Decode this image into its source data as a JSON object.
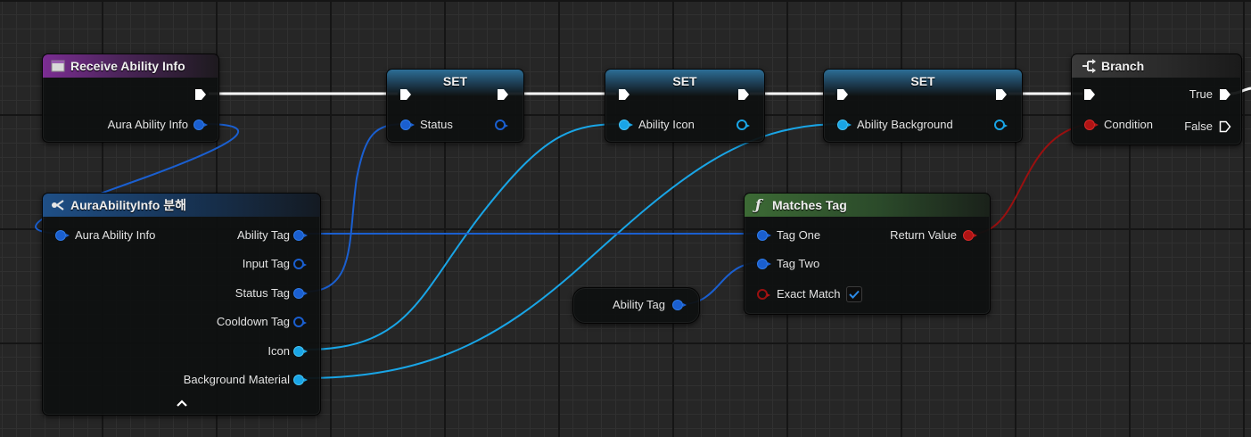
{
  "colors": {
    "grid_background": "#262626",
    "exec_wire": "#ffffff",
    "struct_wire": "#1a5fd0",
    "object_wire": "#19a5e6",
    "bool_wire": "#9a1010"
  },
  "nodes": {
    "receive": {
      "title": "Receive Ability Info",
      "icon": "event-icon",
      "output_pin": "Aura Ability Info"
    },
    "break": {
      "title": "AuraAbilityInfo 분해",
      "icon": "break-struct-icon",
      "input_pin": "Aura Ability Info",
      "outputs": [
        "Ability Tag",
        "Input Tag",
        "Status Tag",
        "Cooldown Tag",
        "Icon",
        "Background Material"
      ],
      "collapse_icon": "chevron-up-icon"
    },
    "set_status": {
      "title": "SET",
      "pin": "Status"
    },
    "set_icon": {
      "title": "SET",
      "pin": "Ability Icon"
    },
    "set_background": {
      "title": "SET",
      "pin": "Ability Background"
    },
    "branch": {
      "title": "Branch",
      "icon": "branch-icon",
      "input_pin": "Condition",
      "true_label": "True",
      "false_label": "False"
    },
    "matches_tag": {
      "title": "Matches Tag",
      "icon": "function-icon",
      "inputs": [
        "Tag One",
        "Tag Two",
        "Exact Match"
      ],
      "output": "Return Value",
      "exact_match_checked": true
    },
    "ability_tag_var": {
      "label": "Ability Tag"
    }
  }
}
